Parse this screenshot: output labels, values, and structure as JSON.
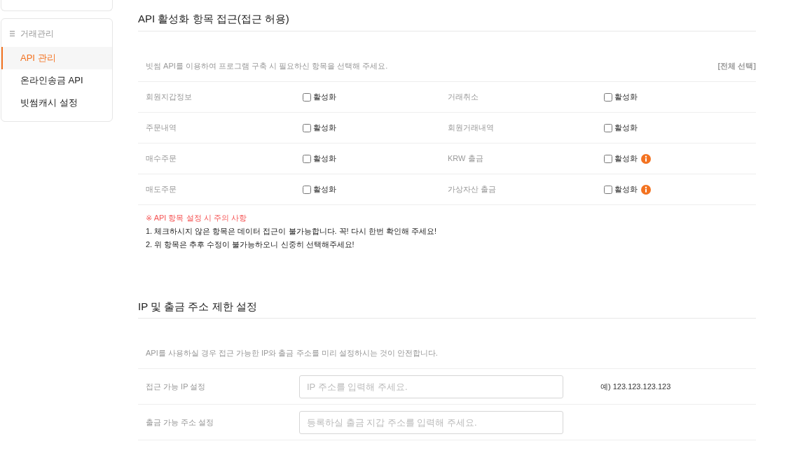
{
  "sidebar": {
    "section": "거래관리",
    "items": [
      {
        "label": "API 관리",
        "selected": true
      },
      {
        "label": "온라인송금 API",
        "selected": false
      },
      {
        "label": "빗썸캐시 설정",
        "selected": false
      }
    ]
  },
  "api_access": {
    "title": "API 활성화 항목 접근(접근 허용)",
    "description": "빗썸 API를 이용하여 프로그램 구축 시 필요하신 항목을 선택해 주세요.",
    "select_all": "[전체 선택]",
    "rows": [
      [
        {
          "name": "회원지갑정보",
          "option": "활성화",
          "checked": false,
          "info": false
        },
        {
          "name": "거래취소",
          "option": "활성화",
          "checked": false,
          "info": false
        }
      ],
      [
        {
          "name": "주문내역",
          "option": "활성화",
          "checked": false,
          "info": false
        },
        {
          "name": "회원거래내역",
          "option": "활성화",
          "checked": false,
          "info": false
        }
      ],
      [
        {
          "name": "매수주문",
          "option": "활성화",
          "checked": false,
          "info": false
        },
        {
          "name": "KRW 출금",
          "option": "활성화",
          "checked": false,
          "info": true
        }
      ],
      [
        {
          "name": "매도주문",
          "option": "활성화",
          "checked": false,
          "info": false
        },
        {
          "name": "가상자산 출금",
          "option": "활성화",
          "checked": false,
          "info": true
        }
      ]
    ],
    "notes": {
      "title": "※ API 항목 설정 시 주의 사항",
      "lines": [
        "1. 체크하시지 않은 항목은 데이터 접근이 불가능합니다. 꼭! 다시 한번 확인해 주세요!",
        "2. 위 항목은 추후 수정이 불가능하오니 신중히 선택해주세요!"
      ]
    }
  },
  "ip_restriction": {
    "title": "IP 및 출금 주소 제한 설정",
    "description": "API를 사용하실 경우 접근 가능한 IP와 출금 주소를 미리 설정하시는 것이 안전합니다.",
    "fields": [
      {
        "label": "접근 가능 IP 설정",
        "placeholder": "IP 주소를 입력해 주세요.",
        "example": "예) 123.123.123.123"
      },
      {
        "label": "출금 가능 주소 설정",
        "placeholder": "등록하실 출금 지갑 주소를 입력해 주세요."
      }
    ]
  }
}
